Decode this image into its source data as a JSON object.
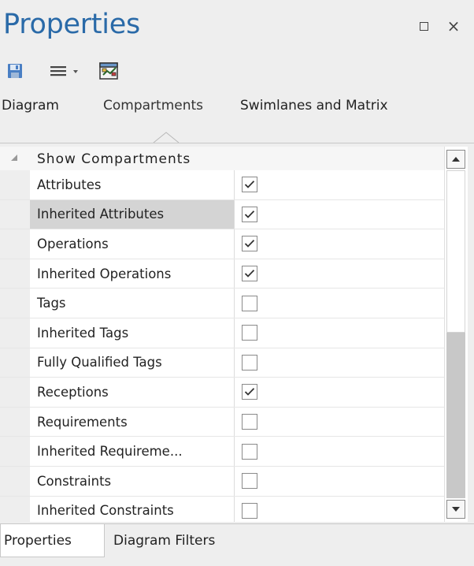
{
  "window": {
    "title": "Properties",
    "maximize_icon": "maximize-icon",
    "close_glyph": "×"
  },
  "toolbar": {
    "save_icon": "save-icon",
    "menu_icon": "hamburger-menu-icon",
    "diagram_icon": "diagram-properties-icon"
  },
  "tabs": [
    {
      "label": "Diagram",
      "active": false
    },
    {
      "label": "Compartments",
      "active": true
    },
    {
      "label": "Swimlanes and Matrix",
      "active": false
    }
  ],
  "group": {
    "label": "Show Compartments",
    "expanded": true
  },
  "properties": [
    {
      "name": "Attributes",
      "checked": true,
      "selected": false
    },
    {
      "name": "Inherited Attributes",
      "checked": true,
      "selected": true
    },
    {
      "name": "Operations",
      "checked": true,
      "selected": false
    },
    {
      "name": "Inherited Operations",
      "checked": true,
      "selected": false
    },
    {
      "name": "Tags",
      "checked": false,
      "selected": false
    },
    {
      "name": "Inherited Tags",
      "checked": false,
      "selected": false
    },
    {
      "name": "Fully Qualified Tags",
      "checked": false,
      "selected": false
    },
    {
      "name": "Receptions",
      "checked": true,
      "selected": false
    },
    {
      "name": "Requirements",
      "checked": false,
      "selected": false
    },
    {
      "name": "Inherited Requireme...",
      "checked": false,
      "selected": false
    },
    {
      "name": "Constraints",
      "checked": false,
      "selected": false
    },
    {
      "name": "Inherited Constraints",
      "checked": false,
      "selected": false
    }
  ],
  "bottom_tabs": [
    {
      "label": "Properties",
      "active": true
    },
    {
      "label": "Diagram Filters",
      "active": false
    }
  ],
  "colors": {
    "title": "#2a6aa8",
    "selected_row": "#d4d4d4",
    "panel_bg": "#eeeeee"
  }
}
